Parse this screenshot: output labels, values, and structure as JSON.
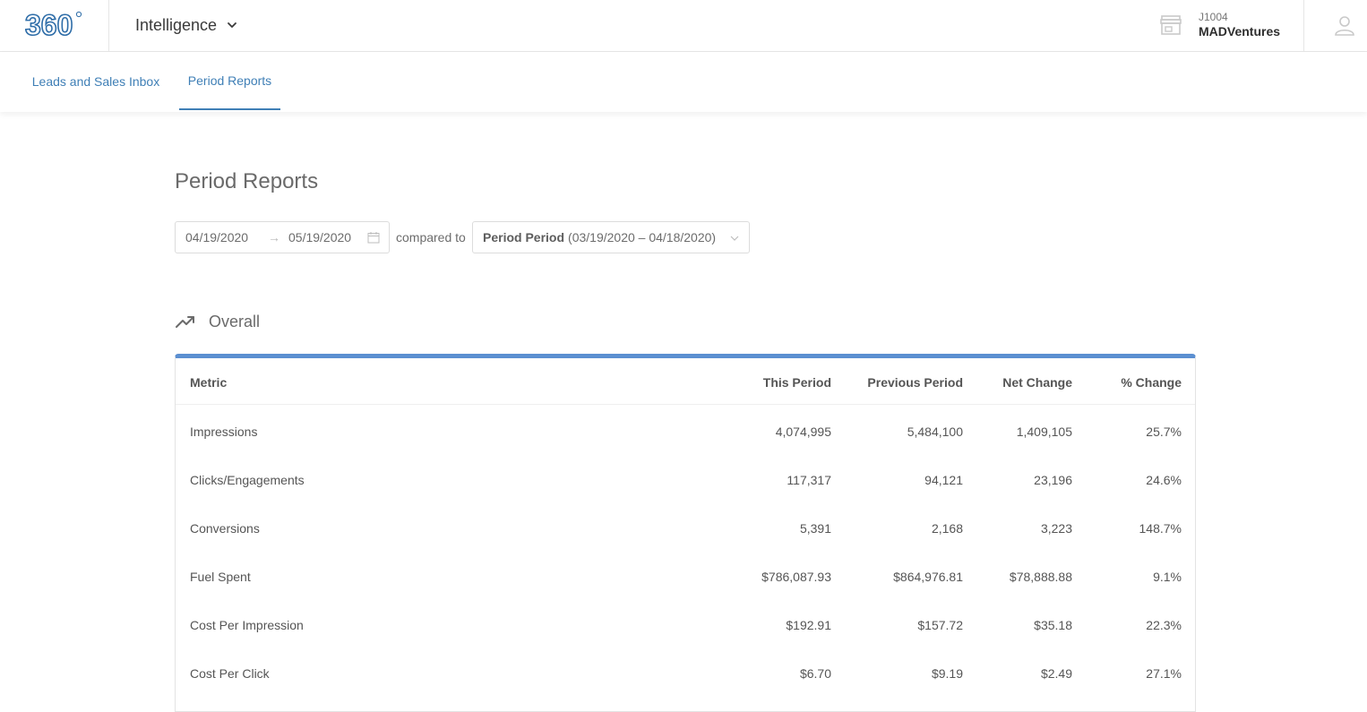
{
  "header": {
    "logo_text": "360",
    "app_name": "Intelligence",
    "account_id": "J1004",
    "account_name": "MADVentures"
  },
  "tabs": [
    {
      "label": "Leads and Sales Inbox",
      "active": false
    },
    {
      "label": "Period Reports",
      "active": true
    }
  ],
  "page": {
    "title": "Period Reports",
    "date_start": "04/19/2020",
    "date_end": "05/19/2020",
    "compared_to_label": "compared to",
    "compare_name": "Period Period",
    "compare_range": "(03/19/2020 – 04/18/2020)"
  },
  "section": {
    "title": "Overall"
  },
  "table": {
    "columns": [
      "Metric",
      "This Period",
      "Previous Period",
      "Net Change",
      "% Change"
    ],
    "rows": [
      [
        "Impressions",
        "4,074,995",
        "5,484,100",
        "1,409,105",
        "25.7%"
      ],
      [
        "Clicks/Engagements",
        "117,317",
        "94,121",
        "23,196",
        "24.6%"
      ],
      [
        "Conversions",
        "5,391",
        "2,168",
        "3,223",
        "148.7%"
      ],
      [
        "Fuel Spent",
        "$786,087.93",
        "$864,976.81",
        "$78,888.88",
        "9.1%"
      ],
      [
        "Cost Per Impression",
        "$192.91",
        "$157.72",
        "$35.18",
        "22.3%"
      ],
      [
        "Cost Per Click",
        "$6.70",
        "$9.19",
        "$2.49",
        "27.1%"
      ]
    ]
  },
  "colors": {
    "accent": "#3f7fb6",
    "table_top_border": "#5b8fd1",
    "logo_blue": "#2e6da8"
  },
  "icons": {
    "app_chevron": "chevron-down-icon",
    "store": "store-icon",
    "user": "user-icon",
    "calendar": "calendar-icon",
    "trend": "trending-up-icon"
  }
}
